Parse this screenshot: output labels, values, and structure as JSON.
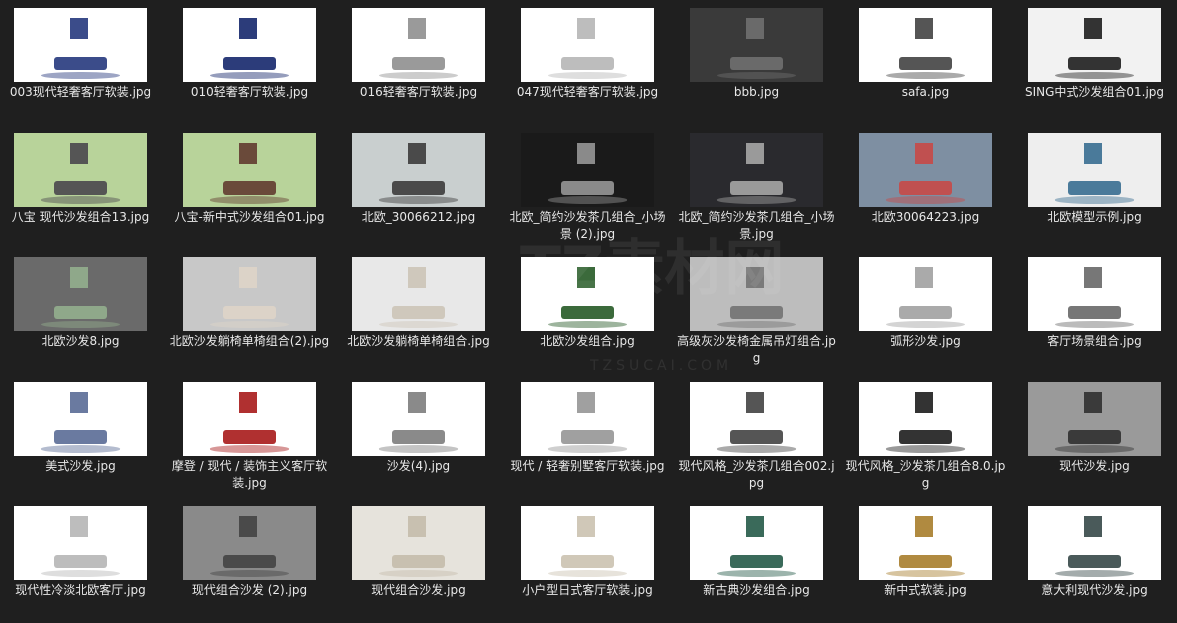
{
  "files": [
    {
      "name": "003现代轻奢客厅软装.jpg",
      "bg": "#ffffff",
      "fg": "#3b4c8a"
    },
    {
      "name": "010轻奢客厅软装.jpg",
      "bg": "#ffffff",
      "fg": "#2c3c7a"
    },
    {
      "name": "016轻奢客厅软装.jpg",
      "bg": "#ffffff",
      "fg": "#9a9a9a"
    },
    {
      "name": "047现代轻奢客厅软装.jpg",
      "bg": "#ffffff",
      "fg": "#bdbdbd"
    },
    {
      "name": "bbb.jpg",
      "bg": "#3a3a3a",
      "fg": "#6a6a6a"
    },
    {
      "name": "safa.jpg",
      "bg": "#ffffff",
      "fg": "#555555"
    },
    {
      "name": "SING中式沙发组合01.jpg",
      "bg": "#f2f2f2",
      "fg": "#333333"
    },
    {
      "name": "八宝 现代沙发组合13.jpg",
      "bg": "#b8d39a",
      "fg": "#555555"
    },
    {
      "name": "八宝-新中式沙发组合01.jpg",
      "bg": "#b8d39a",
      "fg": "#6a4a3a"
    },
    {
      "name": "北欧_30066212.jpg",
      "bg": "#c9cfcf",
      "fg": "#4a4a4a"
    },
    {
      "name": "北欧_简约沙发茶几组合_小场景 (2).jpg",
      "bg": "#1a1a1a",
      "fg": "#8a8a8a"
    },
    {
      "name": "北欧_简约沙发茶几组合_小场景.jpg",
      "bg": "#2a2a2e",
      "fg": "#9a9a9a"
    },
    {
      "name": "北欧30064223.jpg",
      "bg": "#7e8fa2",
      "fg": "#c05050"
    },
    {
      "name": "北欧模型示例.jpg",
      "bg": "#eeeeee",
      "fg": "#4a7a9a"
    },
    {
      "name": "北欧沙发8.jpg",
      "bg": "#6a6a6a",
      "fg": "#8fa88a"
    },
    {
      "name": "北欧沙发躺椅单椅组合(2).jpg",
      "bg": "#c8c8c8",
      "fg": "#dcd3c8"
    },
    {
      "name": "北欧沙发躺椅单椅组合.jpg",
      "bg": "#e8e8e8",
      "fg": "#cfc8bc"
    },
    {
      "name": "北欧沙发组合.jpg",
      "bg": "#ffffff",
      "fg": "#3b6a3b"
    },
    {
      "name": "高级灰沙发椅金属吊灯组合.jpg",
      "bg": "#bdbdbd",
      "fg": "#7a7a7a"
    },
    {
      "name": "弧形沙发.jpg",
      "bg": "#ffffff",
      "fg": "#aaaaaa"
    },
    {
      "name": "客厅场景组合.jpg",
      "bg": "#ffffff",
      "fg": "#777777"
    },
    {
      "name": "美式沙发.jpg",
      "bg": "#ffffff",
      "fg": "#6a7aa0"
    },
    {
      "name": "摩登 / 现代 / 装饰主义客厅软装.jpg",
      "bg": "#ffffff",
      "fg": "#b03030"
    },
    {
      "name": "沙发(4).jpg",
      "bg": "#ffffff",
      "fg": "#8a8a8a"
    },
    {
      "name": "现代 / 轻奢别墅客厅软装.jpg",
      "bg": "#ffffff",
      "fg": "#a0a0a0"
    },
    {
      "name": "现代风格_沙发茶几组合002.jpg",
      "bg": "#ffffff",
      "fg": "#555555"
    },
    {
      "name": "现代风格_沙发茶几组合8.0.jpg",
      "bg": "#ffffff",
      "fg": "#333333"
    },
    {
      "name": "现代沙发.jpg",
      "bg": "#9a9a9a",
      "fg": "#3a3a3a"
    },
    {
      "name": "现代性冷淡北欧客厅.jpg",
      "bg": "#ffffff",
      "fg": "#bdbdbd"
    },
    {
      "name": "现代组合沙发 (2).jpg",
      "bg": "#8a8a8a",
      "fg": "#4a4a4a"
    },
    {
      "name": "现代组合沙发.jpg",
      "bg": "#e6e3dc",
      "fg": "#c8c0b0"
    },
    {
      "name": "小户型日式客厅软装.jpg",
      "bg": "#ffffff",
      "fg": "#d0c8b8"
    },
    {
      "name": "新古典沙发组合.jpg",
      "bg": "#ffffff",
      "fg": "#3a6a5a"
    },
    {
      "name": "新中式软装.jpg",
      "bg": "#ffffff",
      "fg": "#b08a40"
    },
    {
      "name": "意大利现代沙发.jpg",
      "bg": "#ffffff",
      "fg": "#4a5a5a"
    }
  ],
  "watermark": {
    "main": "TZ素材网",
    "sub": "TZSUCAI.COM"
  }
}
